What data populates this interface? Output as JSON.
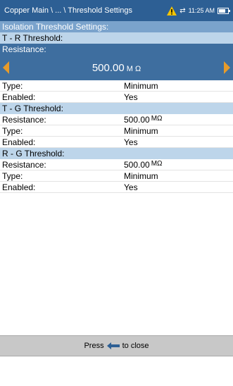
{
  "titlebar": {
    "title": "Copper Main \\ ... \\ Threshold Settings",
    "time": "11:25 AM",
    "icons": [
      "warning-icon",
      "link-icon",
      "battery-icon"
    ]
  },
  "section_title": "Isolation Threshold Settings:",
  "tr": {
    "header": "T - R Threshold:",
    "resistance_label": "Resistance:",
    "resistance_value": "500.00",
    "resistance_unit": "M Ω",
    "type_label": "Type:",
    "type_value": "Minimum",
    "enabled_label": "Enabled:",
    "enabled_value": "Yes"
  },
  "tg": {
    "header": "T - G Threshold:",
    "resistance_label": "Resistance:",
    "resistance_value": "500.00",
    "resistance_unit": "MΩ",
    "type_label": "Type:",
    "type_value": "Minimum",
    "enabled_label": "Enabled:",
    "enabled_value": "Yes"
  },
  "rg": {
    "header": "R - G Threshold:",
    "resistance_label": "Resistance:",
    "resistance_value": "500.00",
    "resistance_unit": "MΩ",
    "type_label": "Type:",
    "type_value": "Minimum",
    "enabled_label": "Enabled:",
    "enabled_value": "Yes"
  },
  "footer": {
    "press": "Press",
    "to_close": "to close"
  },
  "colors": {
    "titlebar": "#2d5f94",
    "section_main": "#7aa3cc",
    "section_header": "#bdd5ea",
    "editor": "#3e6e9f",
    "arrow": "#e79b2a",
    "warning": "#f5c400"
  }
}
